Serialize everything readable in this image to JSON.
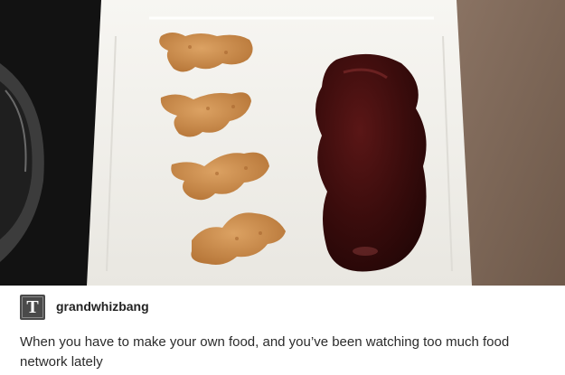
{
  "photo": {
    "description_icon": "dino-nuggets-with-bbq-sauce-photo",
    "colors": {
      "table_dark": "#121212",
      "counter": "#7a6454",
      "plate": "#f4f3ef",
      "nugget": "#c98a4a",
      "sauce": "#3a0c0c"
    }
  },
  "post": {
    "avatar_glyph": "T",
    "username": "grandwhizbang",
    "caption": "When you have to make your own food, and you’ve been watching too much food network lately"
  }
}
